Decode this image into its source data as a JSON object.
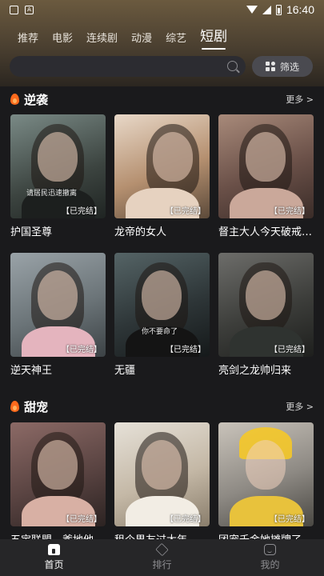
{
  "status_bar": {
    "time": "16:40",
    "left_icons": [
      "image-icon",
      "a-icon"
    ],
    "right_icons": [
      "wifi-icon",
      "signal-icon",
      "battery-icon"
    ]
  },
  "tabs": [
    {
      "label": "推荐",
      "active": false
    },
    {
      "label": "电影",
      "active": false
    },
    {
      "label": "连续剧",
      "active": false
    },
    {
      "label": "动漫",
      "active": false
    },
    {
      "label": "综艺",
      "active": false
    },
    {
      "label": "短剧",
      "active": true
    }
  ],
  "search": {
    "placeholder": "",
    "icon": "search-icon"
  },
  "filter": {
    "label": "筛选",
    "icon": "filter-icon"
  },
  "sections": [
    {
      "title": "逆袭",
      "more": "更多 >",
      "items": [
        {
          "title": "护国圣尊",
          "badge": "【已完结】",
          "caption": "请居民迅速撤离"
        },
        {
          "title": "龙帝的女人",
          "badge": "【已完结】",
          "caption": ""
        },
        {
          "title": "督主大人今天破戒了吗",
          "badge": "【已完结】",
          "caption": ""
        },
        {
          "title": "逆天神王",
          "badge": "【已完结】",
          "caption": ""
        },
        {
          "title": "无疆",
          "badge": "【已完结】",
          "caption": "你不要命了"
        },
        {
          "title": "亮剑之龙帅归来",
          "badge": "【已完结】",
          "caption": ""
        }
      ]
    },
    {
      "title": "甜宠",
      "more": "更多 >",
      "items": [
        {
          "title": "五宝联盟，爹地他",
          "badge": "【已完结】",
          "caption": ""
        },
        {
          "title": "租个男友过大年",
          "badge": "【已完结】",
          "caption": ""
        },
        {
          "title": "团宠千金她摊牌了",
          "badge": "【已完结】",
          "caption": ""
        }
      ]
    }
  ],
  "bottom_nav": [
    {
      "label": "首页",
      "active": true,
      "icon": "home-icon"
    },
    {
      "label": "排行",
      "active": false,
      "icon": "rank-icon"
    },
    {
      "label": "我的",
      "active": false,
      "icon": "profile-icon"
    }
  ],
  "colors": {
    "accent_header": "#6b5a3f",
    "background": "#1a1a1c",
    "flame": "#ff6a1c"
  }
}
